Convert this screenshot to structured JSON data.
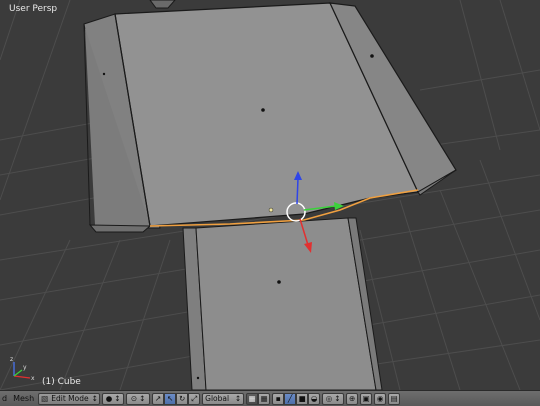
{
  "viewport": {
    "view_name": "User Persp",
    "object_name": "(1) Cube",
    "axis_labels": {
      "x": "x",
      "y": "y",
      "z": "z"
    }
  },
  "header": {
    "menu_fragment": "d",
    "mesh_menu": "Mesh",
    "mode": "Edit Mode",
    "orientation": "Global"
  },
  "colors": {
    "background": "#3b3b3b",
    "grid": "#4a4a4a",
    "mesh_face": "#8f8f8f",
    "mesh_edge": "#1a1a1a",
    "selected_edge": "#f0a040",
    "manipulator_x": "#e23030",
    "manipulator_y": "#3ad23a",
    "manipulator_z": "#2f45e8",
    "active_button": "#5b7dba"
  }
}
